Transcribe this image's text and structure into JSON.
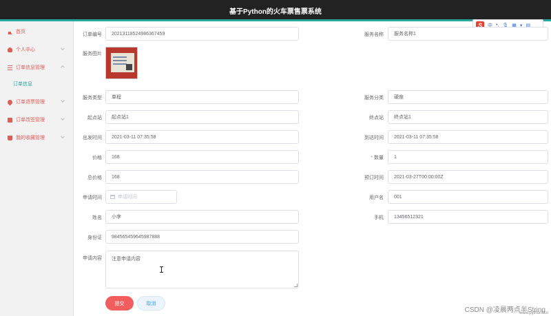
{
  "header": {
    "title": "基于Python的火车票售票系统"
  },
  "ime": {
    "label_lang": "中",
    "label_punct": "•,",
    "label_voice": "🎙"
  },
  "sidebar": {
    "items": [
      {
        "label": "首页"
      },
      {
        "label": "个人中心"
      },
      {
        "label": "订单信息管理"
      },
      {
        "label": "订单信息"
      },
      {
        "label": "订单退票管理"
      },
      {
        "label": "订单改签管理"
      },
      {
        "label": "我的收藏管理"
      }
    ]
  },
  "form": {
    "order_no": {
      "label": "订单编号",
      "value": "20213118524986367459"
    },
    "service_name": {
      "label": "服务名称",
      "value": "服务名称1"
    },
    "service_image": {
      "label": "服务图片"
    },
    "service_type": {
      "label": "服务类型",
      "value": "单程"
    },
    "service_category": {
      "label": "服务分类",
      "value": "硬座"
    },
    "start_station": {
      "label": "起点站",
      "value": "起点站1"
    },
    "end_station": {
      "label": "终点站",
      "value": "终点站1"
    },
    "depart_time": {
      "label": "出发时间",
      "value": "2021-03-11 07:35:58"
    },
    "arrive_time": {
      "label": "到达时间",
      "value": "2021-03-11 07:35:58"
    },
    "price": {
      "label": "价格",
      "value": "168"
    },
    "quantity": {
      "label": "数量",
      "required": "*",
      "value": "1"
    },
    "total_price": {
      "label": "总价格",
      "value": "168"
    },
    "booking_time": {
      "label": "预订时间",
      "value": "2021-03-27T00:00:00Z"
    },
    "apply_time": {
      "label": "申请时间",
      "placeholder": "申请时间"
    },
    "username": {
      "label": "用户名",
      "value": "001"
    },
    "name": {
      "label": "姓名",
      "value": "小李"
    },
    "phone": {
      "label": "手机",
      "value": "13456512321"
    },
    "id_card": {
      "label": "身份证",
      "value": "984565459645987888"
    },
    "apply_content": {
      "label": "申请内容",
      "value": "注意申请内容"
    }
  },
  "buttons": {
    "submit": "提交",
    "cancel": "取消"
  },
  "watermark": {
    "text": "CSDN @凌晨两点半String",
    "url": "www.pythonf.cn"
  }
}
